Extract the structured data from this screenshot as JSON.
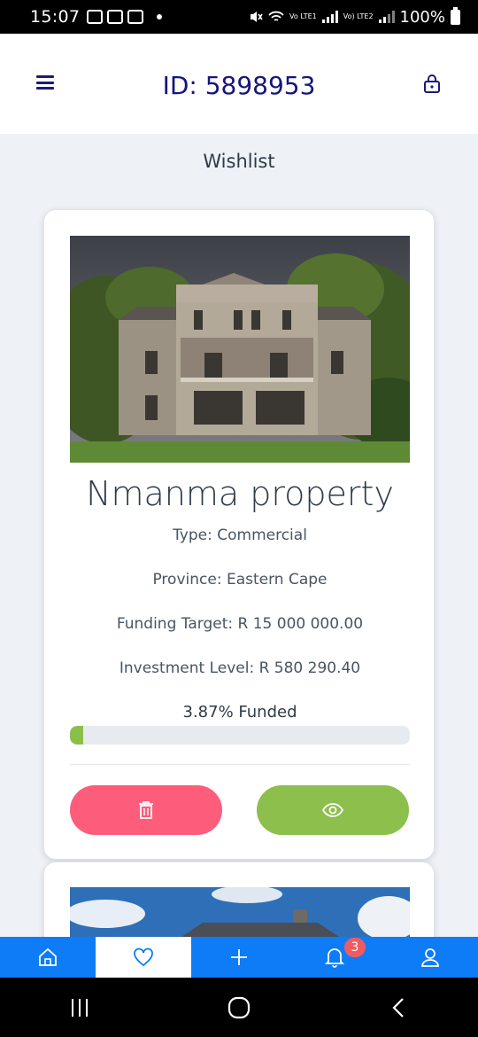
{
  "status_bar": {
    "time": "15:07",
    "carrier1": "Vo LTE1",
    "carrier2": "Vo) LTE2",
    "battery": "100%"
  },
  "header": {
    "title": "ID: 5898953",
    "menu_icon": "hamburger-menu-icon",
    "lock_icon": "lock-icon"
  },
  "page": {
    "section_title": "Wishlist"
  },
  "cards": [
    {
      "name": "Nmanma property",
      "type": "Type: Commercial",
      "province": "Province: Eastern Cape",
      "funding_target": "Funding Target: R 15 000 000.00",
      "investment_level": "Investment Level: R 580 290.40",
      "funded_label": "3.87% Funded",
      "funded_fraction": 0.0387,
      "delete_icon": "trash-icon",
      "view_icon": "eye-icon"
    }
  ],
  "bottom_nav": {
    "items": [
      {
        "icon": "home-icon"
      },
      {
        "icon": "heart-icon",
        "active": true
      },
      {
        "icon": "plus-icon"
      },
      {
        "icon": "bell-icon",
        "badge": "3"
      },
      {
        "icon": "user-icon"
      }
    ]
  },
  "colors": {
    "primary_blue": "#0d7cf6",
    "title_navy": "#15157e",
    "delete_pink": "#fd5c7b",
    "view_green": "#8cbf4c",
    "badge_red": "#f25a62"
  }
}
